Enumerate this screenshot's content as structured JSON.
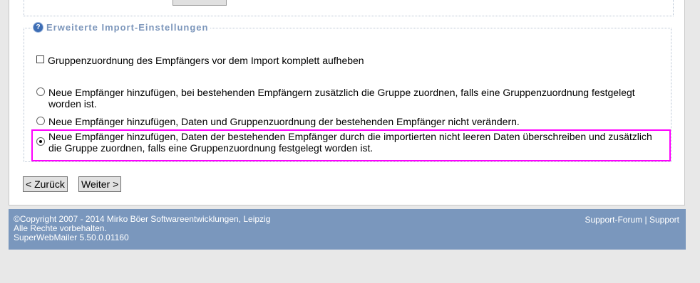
{
  "advanced_settings": {
    "legend": "Erweiterte Import-Einstellungen",
    "remove_group_label": "Gruppenzuordnung des Empfängers vor dem Import komplett aufheben",
    "options": [
      {
        "label": "Neue Empfänger hinzufügen, bei bestehenden Empfängern zusätzlich die Gruppe zuordnen, falls eine Gruppenzuordnung festgelegt worden ist.",
        "selected": false
      },
      {
        "label": "Neue Empfänger hinzufügen, Daten und Gruppenzuordnung der bestehenden Empfänger nicht verändern.",
        "selected": false
      },
      {
        "label": "Neue Empfänger hinzufügen, Daten der bestehenden Empfänger durch die importierten nicht leeren Daten überschreiben und zusätzlich die Gruppe zuordnen, falls eine Gruppenzuordnung festgelegt worden ist.",
        "selected": true
      }
    ]
  },
  "nav": {
    "back_label": "< Zurück",
    "next_label": "Weiter >"
  },
  "footer": {
    "copyright": "©Copyright 2007 - 2014 Mirko Böer Softwareentwicklungen, Leipzig",
    "rights": "Alle Rechte vorbehalten.",
    "version": "SuperWebMailer 5.50.0.01160",
    "support_forum": "Support-Forum",
    "separator": "|",
    "support": "Support"
  },
  "colors": {
    "highlight": "#ff00ff",
    "footer_bg": "#7a97bd",
    "legend_text": "#7c96bb"
  }
}
